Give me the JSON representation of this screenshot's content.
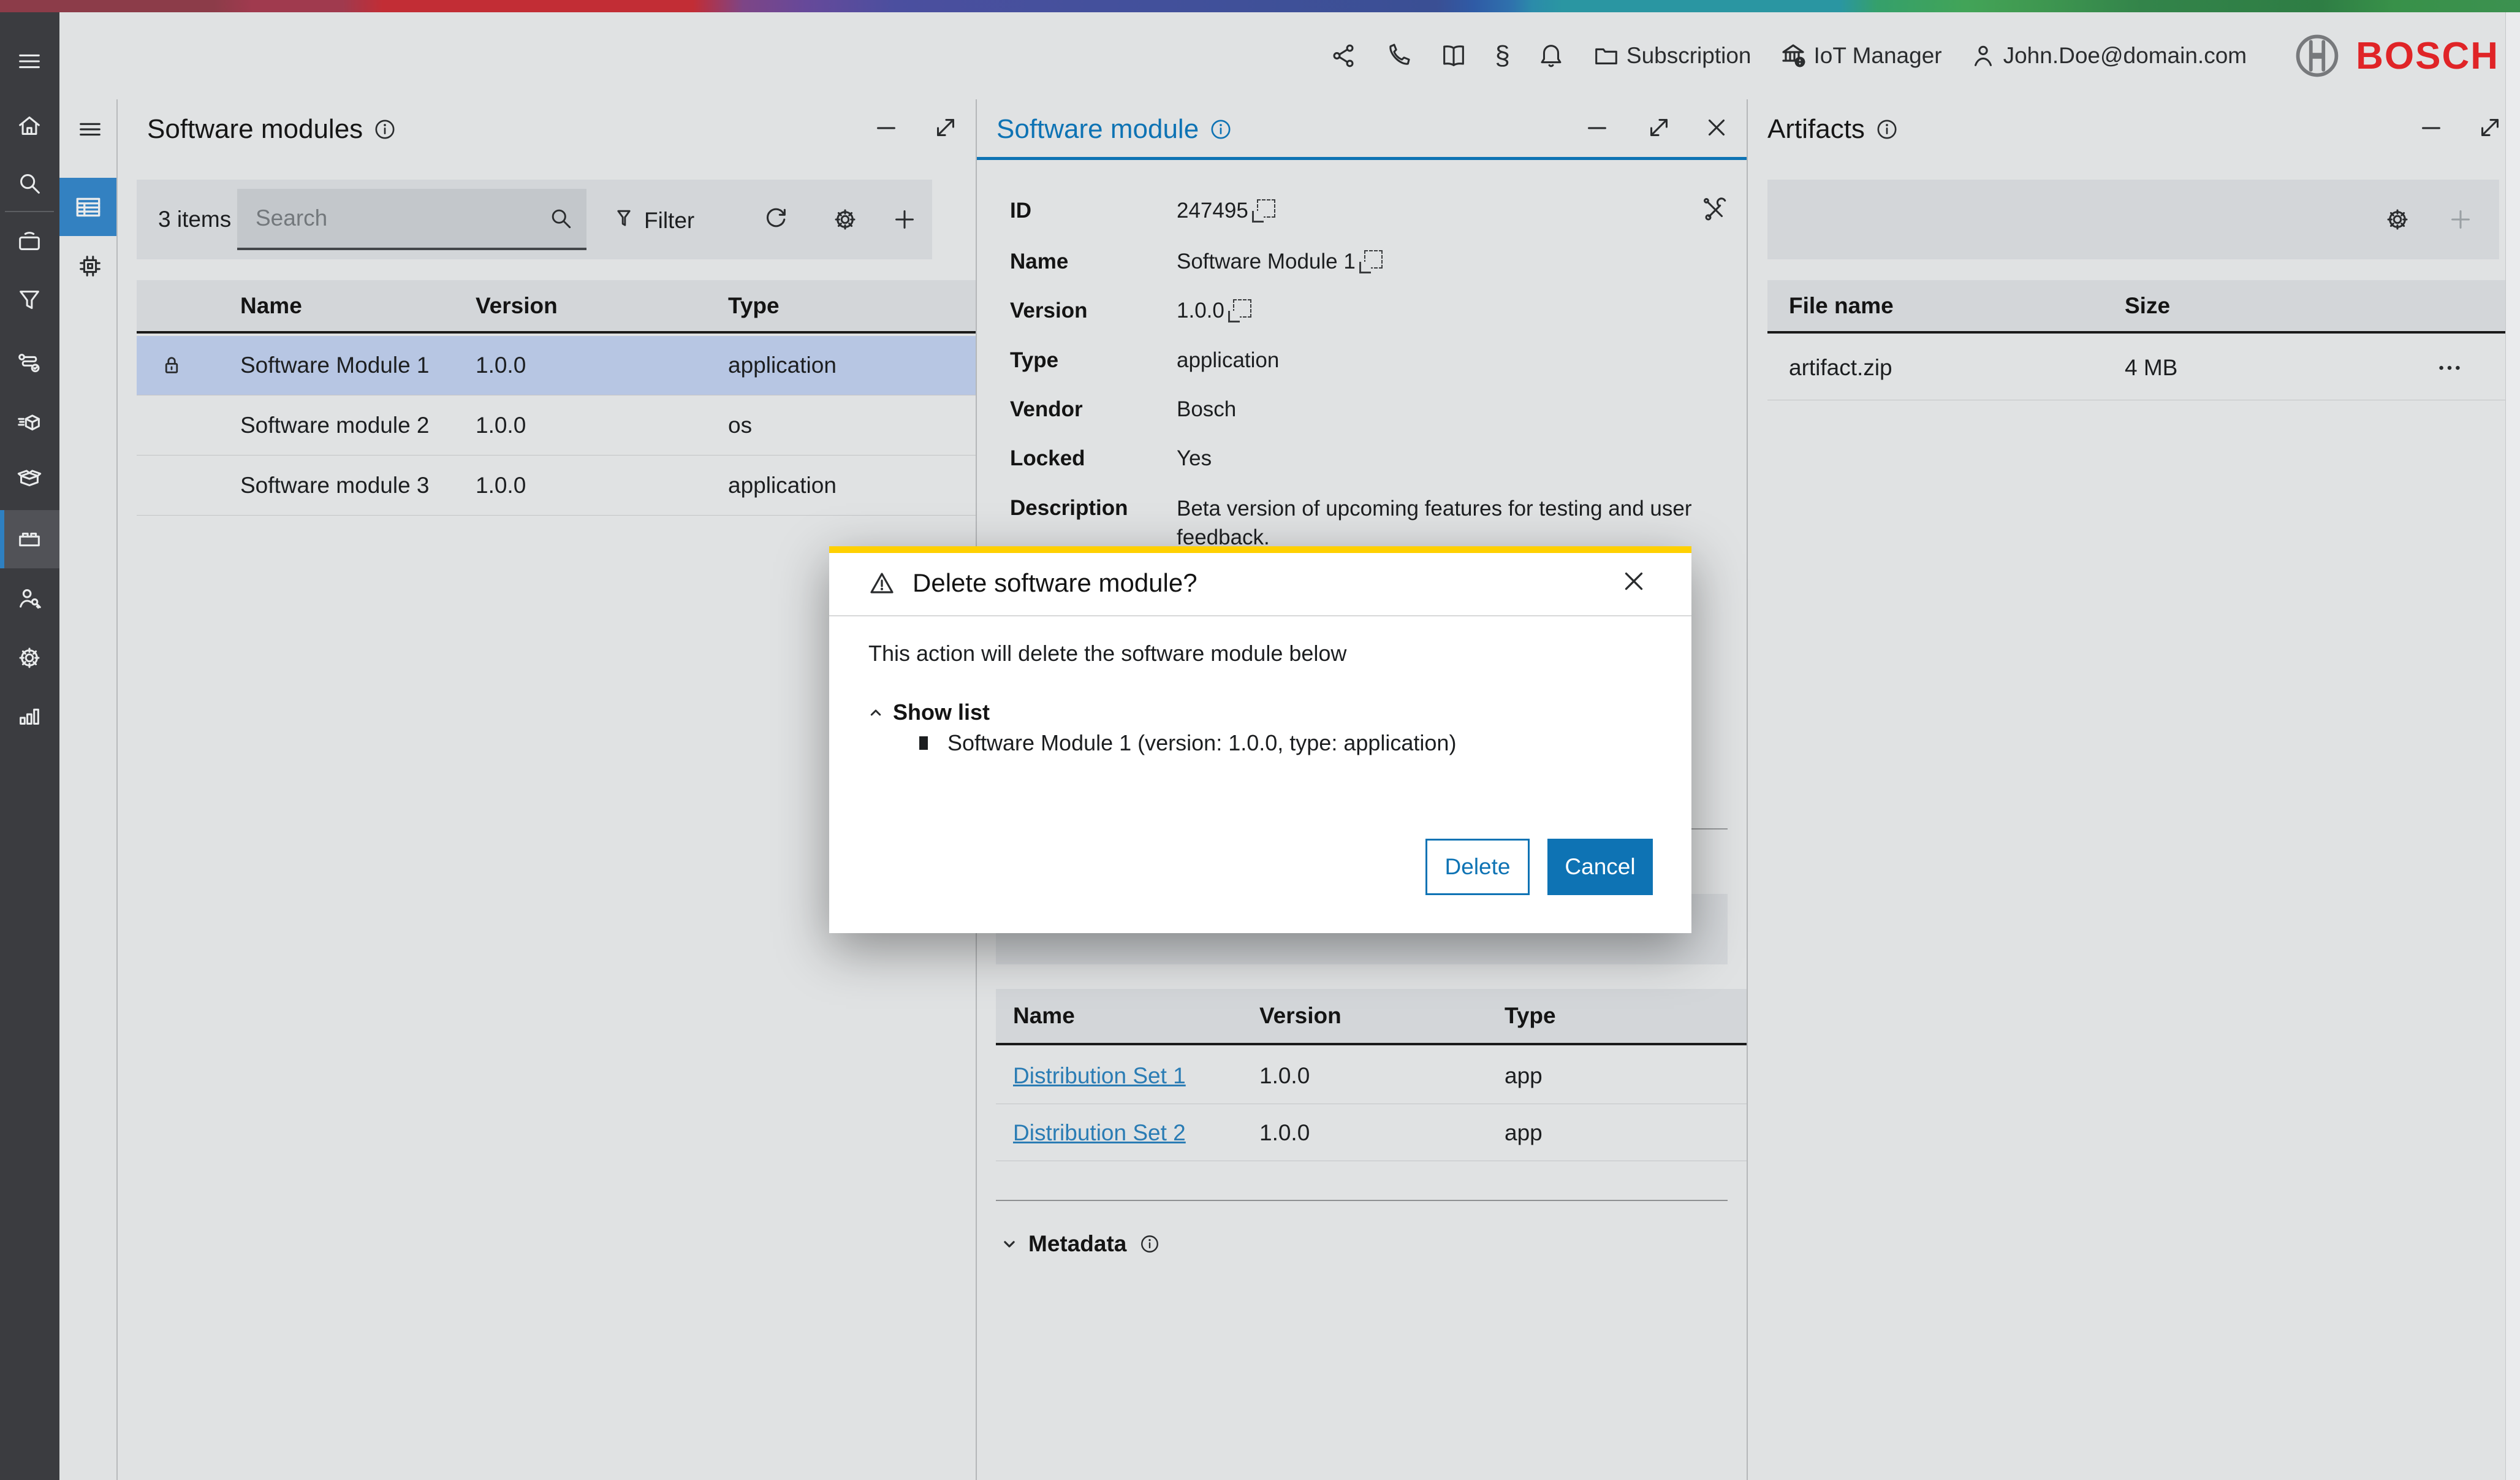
{
  "header": {
    "section_glyph": "§",
    "subscription_label": "Subscription",
    "iot_manager_label": "IoT Manager",
    "user_email": "John.Doe@domain.com",
    "brand": "BOSCH"
  },
  "panels": {
    "software_modules": {
      "title": "Software modules",
      "items_count": "3 items",
      "search_placeholder": "Search",
      "filter_label": "Filter",
      "table": {
        "headers": [
          "Name",
          "Version",
          "Type"
        ],
        "rows": [
          {
            "name": "Software Module 1",
            "version": "1.0.0",
            "type": "application",
            "locked": "yes",
            "selected": "yes"
          },
          {
            "name": "Software module 2",
            "version": "1.0.0",
            "type": "os"
          },
          {
            "name": "Software module 3",
            "version": "1.0.0",
            "type": "application"
          }
        ]
      }
    },
    "software_module": {
      "title": "Software module",
      "details": [
        {
          "label": "ID",
          "value": "247495"
        },
        {
          "label": "Name",
          "value": "Software Module 1"
        },
        {
          "label": "Version",
          "value": "1.0.0"
        },
        {
          "label": "Type",
          "value": "application"
        },
        {
          "label": "Vendor",
          "value": "Bosch"
        },
        {
          "label": "Locked",
          "value": "Yes"
        },
        {
          "label": "Description",
          "value": "Beta version of upcoming features for testing and user feedback."
        }
      ],
      "distribution_sets": {
        "headers": [
          "Name",
          "Version",
          "Type"
        ],
        "rows": [
          {
            "name": "Distribution Set 1",
            "version": "1.0.0",
            "type": "app"
          },
          {
            "name": "Distribution Set 2",
            "version": "1.0.0",
            "type": "app"
          }
        ]
      },
      "metadata_label": "Metadata"
    },
    "artifacts": {
      "title": "Artifacts",
      "table": {
        "headers": [
          "File name",
          "Size"
        ],
        "rows": [
          {
            "file_name": "artifact.zip",
            "size": "4 MB"
          }
        ]
      }
    }
  },
  "modal": {
    "title": "Delete software module?",
    "message": "This action will delete the software module below",
    "show_list_label": "Show list",
    "list_items": [
      "Software Module 1 (version: 1.0.0, type: application)"
    ],
    "delete_label": "Delete",
    "cancel_label": "Cancel"
  },
  "colors": {
    "accent_blue": "#0e73b4",
    "bosch_red": "#e02427",
    "warning_yellow": "#ffd000",
    "selected_row": "#b7c6e3",
    "sidebar_dark": "#3b3c40"
  }
}
